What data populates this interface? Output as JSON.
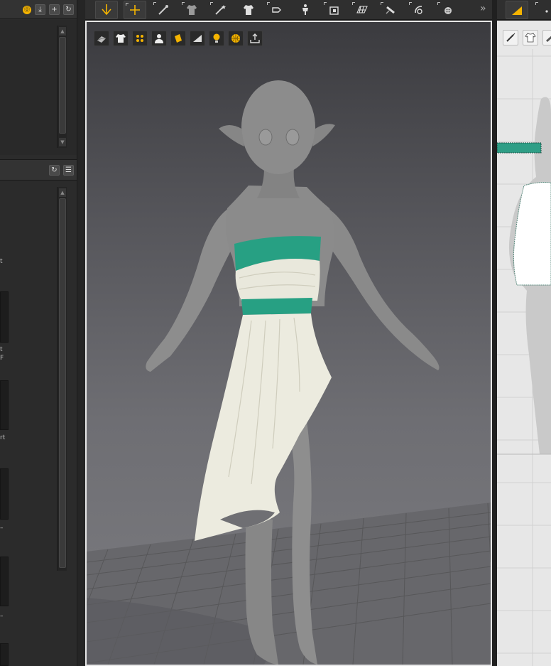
{
  "left_panel": {
    "header_buttons": [
      {
        "icon": "lock-badge-icon",
        "glyph": "⓪"
      },
      {
        "icon": "download-icon",
        "glyph": "⤓"
      },
      {
        "icon": "plus-icon",
        "glyph": "+"
      },
      {
        "icon": "refresh-icon",
        "glyph": "↻"
      }
    ],
    "section_buttons": [
      {
        "icon": "refresh-icon",
        "glyph": "↻"
      },
      {
        "icon": "list-icon",
        "glyph": "☰"
      }
    ],
    "clipped_fragments": [
      "t",
      "t",
      "F",
      "rt",
      "–",
      "–"
    ]
  },
  "toolbar": {
    "tools": [
      {
        "icon": "simulation-arrow-icon",
        "active": true
      },
      {
        "icon": "move-gizmo-icon",
        "active": true
      },
      {
        "icon": "brush-pin-icon",
        "active": false
      },
      {
        "icon": "garment-select-icon",
        "active": false
      },
      {
        "icon": "wand-icon",
        "active": false
      },
      {
        "icon": "tshirt-move-icon",
        "active": false
      },
      {
        "icon": "fold-arrangement-icon",
        "active": false
      },
      {
        "icon": "avatar-arrange-icon",
        "active": false
      },
      {
        "icon": "texture-transform-icon",
        "active": false
      },
      {
        "icon": "grid-pin-icon",
        "active": false
      },
      {
        "icon": "tape-tool-icon",
        "active": false
      },
      {
        "icon": "measure-tool-icon",
        "active": false
      },
      {
        "icon": "button-tool-icon",
        "active": false
      }
    ],
    "more_glyph": "»"
  },
  "viewport": {
    "icons": [
      "garment-display-icon",
      "texture-shirt-icon",
      "particle-points-icon",
      "avatar-display-icon",
      "fabric-swatch-icon",
      "lighting-icon",
      "avatar-bulb-icon",
      "environment-globe-icon",
      "export-tray-icon"
    ],
    "colors": {
      "accent": "#f5b400",
      "garment_white": "#ecebdf",
      "garment_teal": "#27a083",
      "avatar": "#8c8c8c",
      "floor_grid": "#5a5a5e"
    }
  },
  "pattern_panel": {
    "icons": [
      "pen-icon",
      "shirt-icon",
      "blade-icon"
    ],
    "colors": {
      "background": "#e7e7e7",
      "pattern_fill": "#ffffff",
      "band": "#2f9e86"
    }
  }
}
